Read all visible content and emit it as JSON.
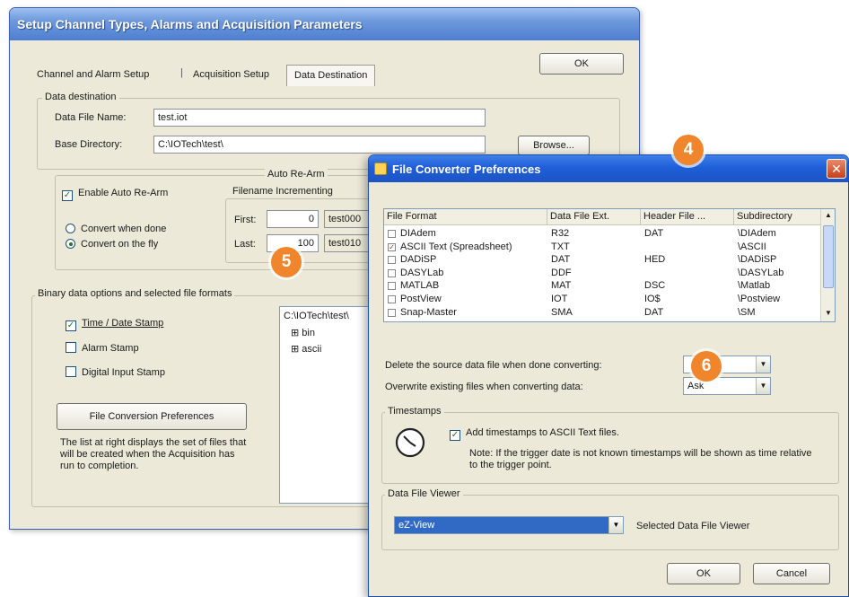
{
  "back_window": {
    "title": "Setup Channel Types, Alarms and Acquisition Parameters",
    "tabs": [
      "Channel and Alarm Setup",
      "Acquisition Setup",
      "Data Destination"
    ],
    "ok_label": "OK",
    "data_destination": {
      "group_label": "Data destination",
      "file_name_label": "Data File Name:",
      "file_name_value": "test.iot",
      "base_dir_label": "Base Directory:",
      "base_dir_value": "C:\\IOTech\\test\\",
      "browse_label": "Browse..."
    },
    "auto_rearm": {
      "group_label": "Auto Re-Arm",
      "enable_label": "Enable Auto Re-Arm",
      "enable_checked": true,
      "convert_done_label": "Convert when done",
      "convert_fly_label": "Convert on the fly",
      "filename_incrementing_label": "Filename Incrementing",
      "first_label": "First:",
      "first_value": "0",
      "first_file": "test000",
      "last_label": "Last:",
      "last_value": "100",
      "last_file": "test010"
    },
    "binary": {
      "group_label": "Binary data options and selected file formats",
      "time_stamp_label": "Time / Date Stamp",
      "alarm_stamp_label": "Alarm Stamp",
      "digital_stamp_label": "Digital Input Stamp",
      "conversion_btn_label": "File Conversion Preferences",
      "description": "The list at right displays the set of files that will be created when the Acquisition has run to completion.",
      "tree_root": "C:\\IOTech\\test\\",
      "tree_items": [
        "bin",
        "ascii"
      ]
    }
  },
  "dialog": {
    "title": "File Converter Preferences",
    "columns": [
      "File Format",
      "Data File Ext.",
      "Header File ...",
      "Subdirectory"
    ],
    "rows": [
      {
        "format": "DIAdem",
        "ext": "R32",
        "header": "DAT",
        "subdir": "\\DIAdem",
        "checked": false
      },
      {
        "format": "ASCII Text (Spreadsheet)",
        "ext": "TXT",
        "header": "",
        "subdir": "\\ASCII",
        "checked": true
      },
      {
        "format": "DADiSP",
        "ext": "DAT",
        "header": "HED",
        "subdir": "\\DADiSP",
        "checked": false
      },
      {
        "format": "DASYLab",
        "ext": "DDF",
        "header": "",
        "subdir": "\\DASYLab",
        "checked": false
      },
      {
        "format": "MATLAB",
        "ext": "MAT",
        "header": "DSC",
        "subdir": "\\Matlab",
        "checked": false
      },
      {
        "format": "PostView",
        "ext": "IOT",
        "header": "IO$",
        "subdir": "\\Postview",
        "checked": false
      },
      {
        "format": "Snap-Master",
        "ext": "SMA",
        "header": "DAT",
        "subdir": "\\SM",
        "checked": false
      }
    ],
    "delete_label": "Delete the source data file when done converting:",
    "delete_value": "",
    "overwrite_label": "Overwrite existing files when converting data:",
    "overwrite_value": "Ask",
    "timestamps_group": "Timestamps",
    "timestamps_check_label": "Add timestamps to ASCII Text files.",
    "timestamps_note": "Note: If the trigger date is not known timestamps will be shown as time relative to the trigger point.",
    "viewer_group": "Data File Viewer",
    "viewer_value": "eZ-View",
    "viewer_caption": "Selected Data File Viewer",
    "ok_label": "OK",
    "cancel_label": "Cancel"
  },
  "callouts": [
    "4",
    "5",
    "6"
  ],
  "colors": {
    "badge": "#f0852b",
    "titlebar_back": "#6d98dc",
    "titlebar_front": "#1f5ed8",
    "selection": "#316ac5"
  }
}
